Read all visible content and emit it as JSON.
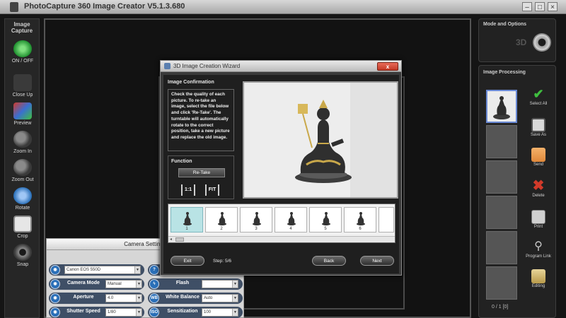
{
  "window": {
    "title": "PhotoCapture 360 Image Creator V5.1.3.680",
    "controls": [
      "–",
      "□",
      "×"
    ]
  },
  "leftbar": {
    "heading": "Image Capture",
    "items": [
      {
        "label": "ON / OFF",
        "icon": "power-icon"
      },
      {
        "label": "Close Up",
        "icon": "closeup-icon"
      },
      {
        "label": "Preview",
        "icon": "preview-icon"
      },
      {
        "label": "Zoom In",
        "icon": "zoom-in-icon"
      },
      {
        "label": "Zoom Out",
        "icon": "zoom-out-icon"
      },
      {
        "label": "Rotate",
        "icon": "rotate-icon"
      },
      {
        "label": "Crop",
        "icon": "crop-icon"
      },
      {
        "label": "Snap",
        "icon": "camera-icon"
      }
    ]
  },
  "modes": {
    "heading": "Mode and Options",
    "tag": "3D"
  },
  "image_processing": {
    "heading": "Image Processing",
    "buttons": [
      {
        "label": "Select All",
        "icon": "checkmark-icon",
        "color": "#3fbf3f"
      },
      {
        "label": "Save As",
        "icon": "save-as-icon",
        "color": "#cfcfcf"
      },
      {
        "label": "Send",
        "icon": "send-icon",
        "color": "#e0883a"
      },
      {
        "label": "Delete",
        "icon": "delete-icon",
        "color": "#d23a2a"
      },
      {
        "label": "Print",
        "icon": "print-icon",
        "color": "#d0d0d0"
      },
      {
        "label": "Program Link",
        "icon": "program-link-icon",
        "color": "#c8c8c8"
      },
      {
        "label": "Editing",
        "icon": "editing-icon",
        "color": "#d8c27a"
      }
    ],
    "page_indicator": "0 / 1 [0]"
  },
  "camera_settings": {
    "title": "Camera Settings",
    "rows": [
      {
        "label": "",
        "value": "Canon EOS 550D",
        "icon_text": "◉"
      },
      {
        "label": "Camera Mode",
        "value": "Manual",
        "icon_text": "◉"
      },
      {
        "label": "Aperture",
        "value": "4.0",
        "icon_text": "◉"
      },
      {
        "label": "Shutter Speed",
        "value": "1/80",
        "icon_text": "◉"
      },
      {
        "label": "Flash",
        "value": "",
        "icon_text": "ϟ"
      },
      {
        "label": "White Balance",
        "value": "Auto",
        "icon_text": "WB"
      },
      {
        "label": "Sensitization",
        "value": "100",
        "icon_text": "ISO"
      }
    ]
  },
  "dialog": {
    "title": "3D Image Creation Wizard",
    "close": "x",
    "confirmation_heading": "Image Confirmation",
    "confirmation_text": "Check the quality of each picture. To re-take an image, select the file below and click 'Re-Take'. The turntable will automatically rotate to the correct position, take a new picture and replace the old image.",
    "function_heading": "Function",
    "retake_label": "Re-Take",
    "actual_size_label": "1:1",
    "fit_label": "FIT",
    "thumbnails": [
      "1",
      "2",
      "3",
      "4",
      "5",
      "6"
    ],
    "selected_thumbnail": 1,
    "exit_label": "Exit",
    "step_text": "Step: 5/6",
    "back_label": "Back",
    "next_label": "Next"
  }
}
